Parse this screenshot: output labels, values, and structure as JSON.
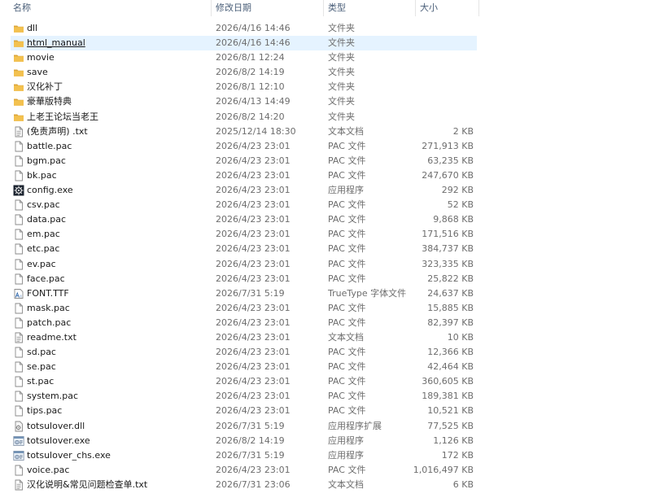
{
  "header": {
    "name": "名称",
    "date": "修改日期",
    "type": "类型",
    "size": "大小",
    "sort_indicator": "^"
  },
  "colors": {
    "folder": "#f3c14f",
    "folder_dark": "#dca53a",
    "selection": "#e5f3ff",
    "header_text": "#4c607a"
  },
  "files": [
    {
      "name": "dll",
      "date": "2026/4/16 14:46",
      "type": "文件夹",
      "size": "",
      "icon": "folder-icon"
    },
    {
      "name": "html_manual",
      "date": "2026/4/16 14:46",
      "type": "文件夹",
      "size": "",
      "icon": "folder-icon",
      "selected": true
    },
    {
      "name": "movie",
      "date": "2026/8/1 12:24",
      "type": "文件夹",
      "size": "",
      "icon": "folder-icon"
    },
    {
      "name": "save",
      "date": "2026/8/2 14:19",
      "type": "文件夹",
      "size": "",
      "icon": "folder-icon"
    },
    {
      "name": "汉化补丁",
      "date": "2026/8/1 12:10",
      "type": "文件夹",
      "size": "",
      "icon": "folder-icon"
    },
    {
      "name": "豪華版特典",
      "date": "2026/4/13 14:49",
      "type": "文件夹",
      "size": "",
      "icon": "folder-icon"
    },
    {
      "name": "上老王论坛当老王",
      "date": "2026/8/2 14:20",
      "type": "文件夹",
      "size": "",
      "icon": "folder-icon"
    },
    {
      "name": "(免责声明) .txt",
      "date": "2025/12/14 18:30",
      "type": "文本文档",
      "size": "2 KB",
      "icon": "text-file-icon"
    },
    {
      "name": "battle.pac",
      "date": "2026/4/23 23:01",
      "type": "PAC 文件",
      "size": "271,913 KB",
      "icon": "file-icon"
    },
    {
      "name": "bgm.pac",
      "date": "2026/4/23 23:01",
      "type": "PAC 文件",
      "size": "63,235 KB",
      "icon": "file-icon"
    },
    {
      "name": "bk.pac",
      "date": "2026/4/23 23:01",
      "type": "PAC 文件",
      "size": "247,670 KB",
      "icon": "file-icon"
    },
    {
      "name": "config.exe",
      "date": "2026/4/23 23:01",
      "type": "应用程序",
      "size": "292 KB",
      "icon": "config-exe-icon"
    },
    {
      "name": "csv.pac",
      "date": "2026/4/23 23:01",
      "type": "PAC 文件",
      "size": "52 KB",
      "icon": "file-icon"
    },
    {
      "name": "data.pac",
      "date": "2026/4/23 23:01",
      "type": "PAC 文件",
      "size": "9,868 KB",
      "icon": "file-icon"
    },
    {
      "name": "em.pac",
      "date": "2026/4/23 23:01",
      "type": "PAC 文件",
      "size": "171,516 KB",
      "icon": "file-icon"
    },
    {
      "name": "etc.pac",
      "date": "2026/4/23 23:01",
      "type": "PAC 文件",
      "size": "384,737 KB",
      "icon": "file-icon"
    },
    {
      "name": "ev.pac",
      "date": "2026/4/23 23:01",
      "type": "PAC 文件",
      "size": "323,335 KB",
      "icon": "file-icon"
    },
    {
      "name": "face.pac",
      "date": "2026/4/23 23:01",
      "type": "PAC 文件",
      "size": "25,822 KB",
      "icon": "file-icon"
    },
    {
      "name": "FONT.TTF",
      "date": "2026/7/31 5:19",
      "type": "TrueType 字体文件",
      "size": "24,637 KB",
      "icon": "font-file-icon"
    },
    {
      "name": "mask.pac",
      "date": "2026/4/23 23:01",
      "type": "PAC 文件",
      "size": "15,885 KB",
      "icon": "file-icon"
    },
    {
      "name": "patch.pac",
      "date": "2026/4/23 23:01",
      "type": "PAC 文件",
      "size": "82,397 KB",
      "icon": "file-icon"
    },
    {
      "name": "readme.txt",
      "date": "2026/4/23 23:01",
      "type": "文本文档",
      "size": "10 KB",
      "icon": "text-file-icon"
    },
    {
      "name": "sd.pac",
      "date": "2026/4/23 23:01",
      "type": "PAC 文件",
      "size": "12,366 KB",
      "icon": "file-icon"
    },
    {
      "name": "se.pac",
      "date": "2026/4/23 23:01",
      "type": "PAC 文件",
      "size": "42,464 KB",
      "icon": "file-icon"
    },
    {
      "name": "st.pac",
      "date": "2026/4/23 23:01",
      "type": "PAC 文件",
      "size": "360,605 KB",
      "icon": "file-icon"
    },
    {
      "name": "system.pac",
      "date": "2026/4/23 23:01",
      "type": "PAC 文件",
      "size": "189,381 KB",
      "icon": "file-icon"
    },
    {
      "name": "tips.pac",
      "date": "2026/4/23 23:01",
      "type": "PAC 文件",
      "size": "10,521 KB",
      "icon": "file-icon"
    },
    {
      "name": "totsulover.dll",
      "date": "2026/7/31 5:19",
      "type": "应用程序扩展",
      "size": "77,525 KB",
      "icon": "dll-file-icon"
    },
    {
      "name": "totsulover.exe",
      "date": "2026/8/2 14:19",
      "type": "应用程序",
      "size": "1,126 KB",
      "icon": "exe-file-icon"
    },
    {
      "name": "totsulover_chs.exe",
      "date": "2026/7/31 5:19",
      "type": "应用程序",
      "size": "172 KB",
      "icon": "exe-file-icon"
    },
    {
      "name": "voice.pac",
      "date": "2026/4/23 23:01",
      "type": "PAC 文件",
      "size": "1,016,497 KB",
      "icon": "file-icon"
    },
    {
      "name": "汉化说明&常见问题检查单.txt",
      "date": "2026/7/31 23:06",
      "type": "文本文档",
      "size": "6 KB",
      "icon": "text-file-icon"
    }
  ]
}
